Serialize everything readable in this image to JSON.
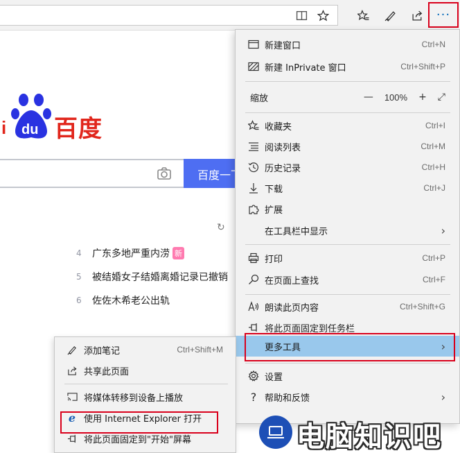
{
  "colors": {
    "accent_red": "#d9001b",
    "highlight": "#99c8ec",
    "menu_bg": "#f2f2f2",
    "baidu_blue": "#4e6ef2",
    "baidu_red": "#e1261c"
  },
  "toolbar": {
    "icons": [
      "reading-view-icon",
      "favorite-star-icon",
      "favorites-icon",
      "notes-pen-icon",
      "share-icon"
    ],
    "more_label": "···"
  },
  "page": {
    "logo_text": "百度",
    "logo_prefix": "i",
    "logo_paw": "du",
    "search_button": "百度一下",
    "hot_list": [
      {
        "index": "4",
        "title": "广东多地严重内涝",
        "badge": "新"
      },
      {
        "index": "5",
        "title": "被结婚女子结婚离婚记录已撤销",
        "badge": ""
      },
      {
        "index": "6",
        "title": "佐佐木希老公出轨",
        "badge": ""
      }
    ]
  },
  "menu": {
    "new_window": {
      "label": "新建窗口",
      "shortcut": "Ctrl+N"
    },
    "new_inprivate": {
      "label": "新建 InPrivate 窗口",
      "shortcut": "Ctrl+Shift+P"
    },
    "zoom": {
      "label": "缩放",
      "minus": "—",
      "value": "100%",
      "plus": "+",
      "fullscreen": "⤢"
    },
    "favorites": {
      "label": "收藏夹",
      "shortcut": "Ctrl+I"
    },
    "reading_list": {
      "label": "阅读列表",
      "shortcut": "Ctrl+M"
    },
    "history": {
      "label": "历史记录",
      "shortcut": "Ctrl+H"
    },
    "downloads": {
      "label": "下载",
      "shortcut": "Ctrl+J"
    },
    "extensions": {
      "label": "扩展"
    },
    "show_in_toolbar": {
      "label": "在工具栏中显示",
      "arrow": "›"
    },
    "print": {
      "label": "打印",
      "shortcut": "Ctrl+P"
    },
    "find": {
      "label": "在页面上查找",
      "shortcut": "Ctrl+F"
    },
    "read_aloud": {
      "label": "朗读此页内容",
      "shortcut": "Ctrl+Shift+G"
    },
    "pin_taskbar": {
      "label": "将此页面固定到任务栏"
    },
    "more_tools": {
      "label": "更多工具",
      "arrow": "›"
    },
    "settings": {
      "label": "设置"
    },
    "help": {
      "label": "帮助和反馈",
      "arrow": "›"
    }
  },
  "submenu": {
    "add_notes": {
      "label": "添加笔记",
      "shortcut": "Ctrl+Shift+M"
    },
    "share_page": {
      "label": "共享此页面"
    },
    "cast_media": {
      "label": "将媒体转移到设备上播放"
    },
    "open_ie": {
      "label": "使用 Internet Explorer 打开"
    },
    "pin_start": {
      "label": "将此页面固定到\"开始\"屏幕"
    }
  },
  "watermark": {
    "text": "电脑知识吧"
  }
}
